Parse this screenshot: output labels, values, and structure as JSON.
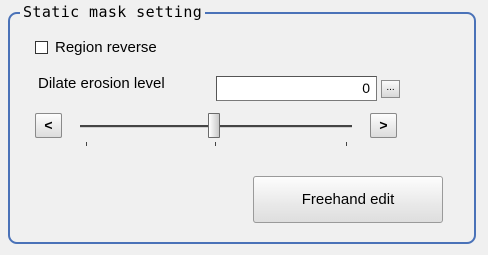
{
  "group": {
    "title": "Static mask setting"
  },
  "region_reverse": {
    "label": "Region reverse",
    "checked": false
  },
  "dilate": {
    "label": "Dilate erosion level",
    "value": "0",
    "browse_label": "...",
    "slider_value": 0
  },
  "slider": {
    "left_label": "<",
    "right_label": ">"
  },
  "freehand": {
    "label": "Freehand edit"
  },
  "colors": {
    "group_border": "#4a72b8",
    "background": "#f0f0f0"
  }
}
